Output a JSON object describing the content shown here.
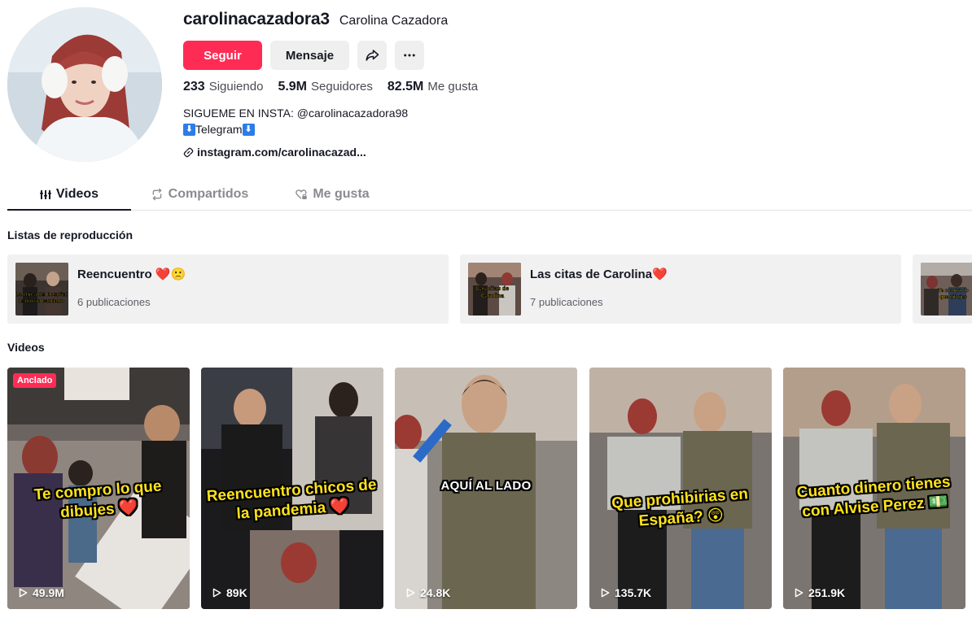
{
  "profile": {
    "username": "carolinacazadora3",
    "nickname": "Carolina Cazadora",
    "follow_label": "Seguir",
    "message_label": "Mensaje",
    "stats": [
      {
        "value": "233",
        "label": "Siguiendo"
      },
      {
        "value": "5.9M",
        "label": "Seguidores"
      },
      {
        "value": "82.5M",
        "label": "Me gusta"
      }
    ],
    "bio_line1": "SIGUEME EN INSTA: @carolinacazadora98",
    "bio_telegram": "Telegram",
    "bio_arrow": "⬇",
    "link": "instagram.com/carolinacazad..."
  },
  "tabs": [
    {
      "label": "Videos",
      "icon": "grid-bars-icon"
    },
    {
      "label": "Compartidos",
      "icon": "repost-icon"
    },
    {
      "label": "Me gusta",
      "icon": "heart-lock-icon"
    }
  ],
  "playlists_title": "Listas de reproducción",
  "playlists": [
    {
      "name": "Reencuentro ❤️🙁",
      "count": "6 publicaciones",
      "thumb_text": "La chica del hospital le dio un candado"
    },
    {
      "name": "Las citas de Carolina❤️",
      "count": "7 publicaciones",
      "thumb_text": "Las citas de Carolina"
    },
    {
      "name": "",
      "count": "",
      "thumb_text": "Te compro lo que dibujes"
    }
  ],
  "videos_title": "Videos",
  "videos": [
    {
      "caption": "Te compro lo que dibujes ❤️",
      "views": "49.9M",
      "pinned_label": "Anclado"
    },
    {
      "caption": "Reencuentro chicos de la pandemia ❤️",
      "views": "89K"
    },
    {
      "caption": "AQUÍ AL LADO",
      "views": "24.8K"
    },
    {
      "caption": "Que prohibirias en España? 😲",
      "views": "135.7K"
    },
    {
      "caption": "Cuanto dinero tienes con Alvise Perez 💵",
      "views": "251.9K"
    }
  ],
  "colors": {
    "accent": "#fe2c55",
    "text": "#161823",
    "caption_yellow": "#ffe21a"
  }
}
